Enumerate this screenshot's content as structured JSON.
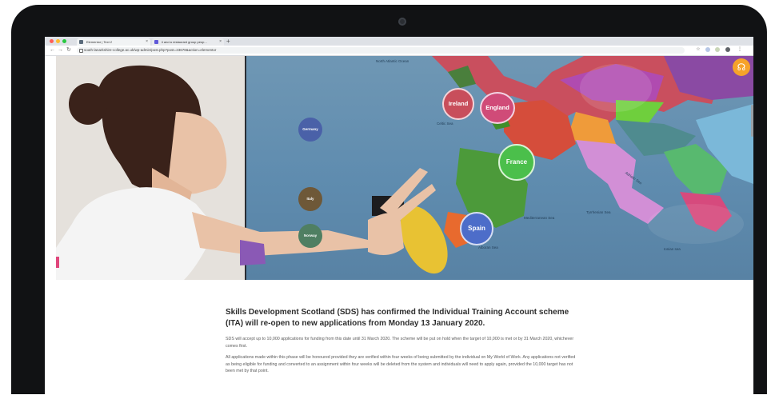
{
  "browser": {
    "tabs": [
      {
        "label": "Elementor | Text 2",
        "favicon_color": "#5a6b7b"
      },
      {
        "label": "ii and a restaurant group peop... ",
        "favicon_color": "#5f59d9"
      }
    ],
    "url": "south-lanarkshire-college.ac.uk/wp-admin/post.php?post=23678&action=elementor"
  },
  "hero": {
    "map_labels": {
      "ireland": "Ireland",
      "england": "England",
      "france": "France",
      "spain": "Spain",
      "germany": "Germany",
      "italy": "Italy",
      "norway": "Norway",
      "celtic_sea": "Celtic Sea",
      "mediterranean_sea": "Mediterranean Sea",
      "tyrrhenian_sea": "Tyrrhenian Sea",
      "adriatic_sea": "Adriatic Sea",
      "alboran_sea": "Alboran Sea",
      "ionian_sea": "Ionian sea",
      "north_atlantic_ocean": "North Atlantic Ocean"
    },
    "help_icon": "headset-icon"
  },
  "article": {
    "heading": "Skills Development Scotland (SDS) has confirmed the Individual Training Account scheme (ITA) will re-open to new applications from Monday 13 January 2020.",
    "para1": "SDS will accept up to 10,000 applications for funding from this date until 31 March 2020. The scheme will be put on hold when the target of 10,000 is met or by 31 March 2020, whichever comes first.",
    "para2": "All applications made within this phase will be honoured provided they are verified within four weeks of being submitted by the individual on My World of Work. Any applications not verified as being eligible for funding and converted to an assignment within four weeks will be deleted from the system and individuals will need to apply again, provided the 10,000 target has not been met by that point."
  },
  "colors": {
    "monitor": "#111214",
    "help_button": "#f6a32a",
    "map_sea": "#6f97b4"
  }
}
